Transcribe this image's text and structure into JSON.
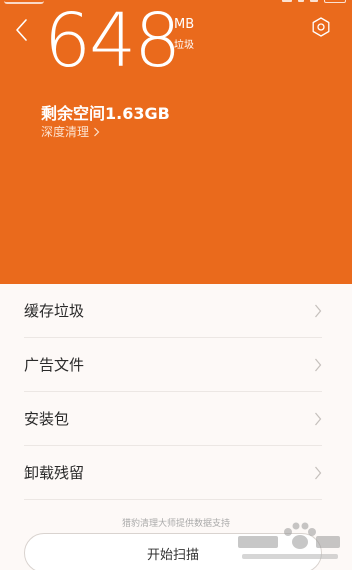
{
  "header": {
    "size_value": "648",
    "size_unit": "MB",
    "size_unit_cn": "垃圾",
    "remaining_space": "剩余空间1.63GB",
    "deep_clean_label": "深度清理"
  },
  "categories": [
    {
      "label": "缓存垃圾"
    },
    {
      "label": "广告文件"
    },
    {
      "label": "安装包"
    },
    {
      "label": "卸载残留"
    }
  ],
  "footer": {
    "powered_by": "猎豹清理大师提供数据支持",
    "scan_button_label": "开始扫描"
  },
  "colors": {
    "accent": "#ea6a1c",
    "background": "#fdf9f7",
    "divider": "#ece7e4"
  },
  "icons": [
    "back-arrow-icon",
    "settings-icon",
    "chevron-right-icon"
  ]
}
